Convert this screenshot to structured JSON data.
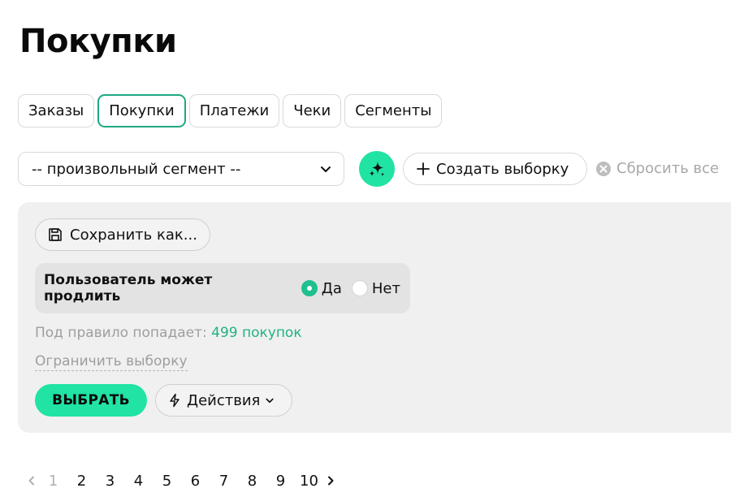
{
  "page": {
    "title": "Покупки"
  },
  "tabs": [
    {
      "label": "Заказы",
      "active": false
    },
    {
      "label": "Покупки",
      "active": true
    },
    {
      "label": "Платежи",
      "active": false
    },
    {
      "label": "Чеки",
      "active": false
    },
    {
      "label": "Сегменты",
      "active": false
    }
  ],
  "toolbar": {
    "segment_value": "-- произвольный сегмент --",
    "create_label": "Создать выборку",
    "reset_label": "Сбросить все"
  },
  "filter": {
    "save_as_label": "Сохранить как...",
    "rule_label": "Пользователь может продлить",
    "options": [
      {
        "label": "Да",
        "checked": true
      },
      {
        "label": "Нет",
        "checked": false
      }
    ],
    "count_prefix": "Под правило попадает:",
    "count_value": "499 покупок",
    "limit_label": "Ограничить выборку",
    "select_label": "ВЫБРАТЬ",
    "actions_label": "Действия"
  },
  "pagination": {
    "current": 1,
    "pages": [
      "1",
      "2",
      "3",
      "4",
      "5",
      "6",
      "7",
      "8",
      "9",
      "10"
    ]
  },
  "colors": {
    "accent": "#20e3a4",
    "accent_dark": "#1fa883",
    "muted": "#9e9e9e",
    "panel_bg": "#f0f0f0"
  },
  "icons": {
    "ai": "sparkle-icon",
    "create": "plus-icon",
    "reset": "close-circle-icon",
    "save": "floppy-disk-icon",
    "actions": "lightning-icon",
    "select_chevron": "chevron-down-icon",
    "prev": "chevron-left-icon",
    "next": "chevron-right-icon"
  }
}
